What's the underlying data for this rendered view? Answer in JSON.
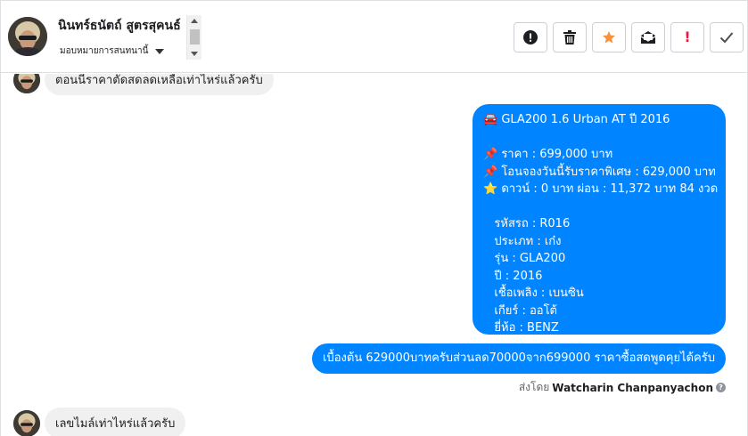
{
  "header": {
    "contact_name": "นินทร์ธนัตถ์ สูตรสุคนธ์",
    "assign_label": "มอบหมายการสนทนานี้",
    "tools": [
      {
        "name": "mark-spam",
        "icon": "exclamation-circle-icon"
      },
      {
        "name": "delete",
        "icon": "trash-icon"
      },
      {
        "name": "star",
        "icon": "star-icon"
      },
      {
        "name": "mark-unread",
        "icon": "envelope-icon"
      },
      {
        "name": "follow-up",
        "icon": "exclamation-icon",
        "glyph": "!"
      },
      {
        "name": "done",
        "icon": "checkmark-icon"
      }
    ]
  },
  "messages": {
    "incoming_top": "ตอนนี้ราคาตัดสดลดเหลือเท่าไหร่แล้วครับ",
    "outgoing_listing": "🚘 GLA200 1.6 Urban AT ปี 2016\n\n📌 ราคา : 699,000 บาท\n📌 โอนจองวันนี้รับราคาพิเศษ : 629,000 บาท\n⭐ ดาวน์ : 0 บาท ผ่อน : 11,372 บาท 84 งวด\n\n   รหัสรถ : R016\n   ประเภท : เก๋ง\n   รุ่น : GLA200\n   ปี : 2016\n   เชื้อเพลิง : เบนซิน\n   เกียร์ : ออโต้\n   ยี่ห้อ : BENZ",
    "outgoing_price": "เบื้องต้น 629000บาทครับส่วนลด70000จาก699000 ราคาซื้อสดพูดคุยได้ครับ",
    "sent_by_label": "ส่งโดย",
    "sent_by_name": "Watcharin Chanpanyachon",
    "incoming_bottom": "เลขไมล์เท่าไหร่แล้วครับ"
  },
  "colors": {
    "accent": "#0084ff",
    "star": "#f7923b",
    "follow_up": "#e41e3f"
  }
}
